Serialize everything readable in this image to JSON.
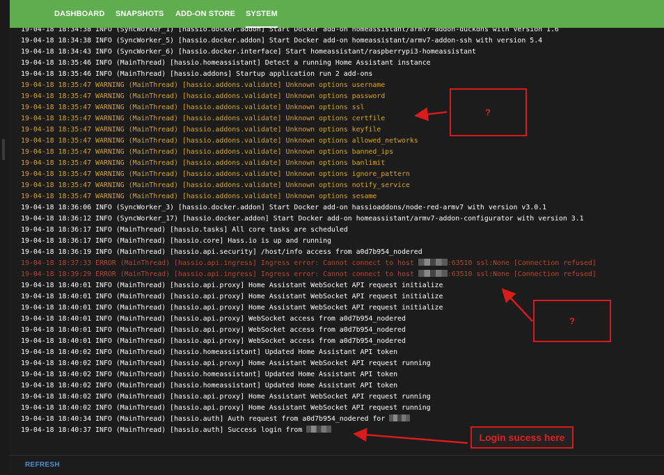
{
  "nav": {
    "tabs": [
      {
        "label": "DASHBOARD"
      },
      {
        "label": "SNAPSHOTS"
      },
      {
        "label": "ADD-ON STORE"
      },
      {
        "label": "SYSTEM"
      }
    ]
  },
  "log": {
    "lines": [
      {
        "level": "info",
        "text": "19-04-18 18:34:38 INFO (SyncWorker_1) [hassio.docker.addon] Start Docker add-on homeassistant/armv7-addon-duckdns with version 1.6"
      },
      {
        "level": "info",
        "text": "19-04-18 18:34:38 INFO (SyncWorker_5) [hassio.docker.addon] Start Docker add-on homeassistant/armv7-addon-ssh with version 5.4"
      },
      {
        "level": "info",
        "text": "19-04-18 18:34:43 INFO (SyncWorker_6) [hassio.docker.interface] Start homeassistant/raspberrypi3-homeassistant"
      },
      {
        "level": "info",
        "text": "19-04-18 18:35:46 INFO (MainThread) [hassio.homeassistant] Detect a running Home Assistant instance"
      },
      {
        "level": "info",
        "text": "19-04-18 18:35:46 INFO (MainThread) [hassio.addons] Startup application run 2 add-ons"
      },
      {
        "level": "warn",
        "text": "19-04-18 18:35:47 WARNING (MainThread) [hassio.addons.validate] Unknown options username"
      },
      {
        "level": "warn",
        "text": "19-04-18 18:35:47 WARNING (MainThread) [hassio.addons.validate] Unknown options password"
      },
      {
        "level": "warn",
        "text": "19-04-18 18:35:47 WARNING (MainThread) [hassio.addons.validate] Unknown options ssl"
      },
      {
        "level": "warn",
        "text": "19-04-18 18:35:47 WARNING (MainThread) [hassio.addons.validate] Unknown options certfile"
      },
      {
        "level": "warn",
        "text": "19-04-18 18:35:47 WARNING (MainThread) [hassio.addons.validate] Unknown options keyfile"
      },
      {
        "level": "warn",
        "text": "19-04-18 18:35:47 WARNING (MainThread) [hassio.addons.validate] Unknown options allowed_networks"
      },
      {
        "level": "warn",
        "text": "19-04-18 18:35:47 WARNING (MainThread) [hassio.addons.validate] Unknown options banned_ips"
      },
      {
        "level": "warn",
        "text": "19-04-18 18:35:47 WARNING (MainThread) [hassio.addons.validate] Unknown options banlimit"
      },
      {
        "level": "warn",
        "text": "19-04-18 18:35:47 WARNING (MainThread) [hassio.addons.validate] Unknown options ignore_pattern"
      },
      {
        "level": "warn",
        "text": "19-04-18 18:35:47 WARNING (MainThread) [hassio.addons.validate] Unknown options notify_service"
      },
      {
        "level": "warn",
        "text": "19-04-18 18:35:47 WARNING (MainThread) [hassio.addons.validate] Unknown options sesame"
      },
      {
        "level": "info",
        "text": "19-04-18 18:36:06 INFO (SyncWorker_3) [hassio.docker.addon] Start Docker add-on hassioaddons/node-red-armv7 with version v3.0.1"
      },
      {
        "level": "info",
        "text": "19-04-18 18:36:12 INFO (SyncWorker_17) [hassio.docker.addon] Start Docker add-on homeassistant/armv7-addon-configurator with version 3.1"
      },
      {
        "level": "info",
        "text": "19-04-18 18:36:17 INFO (MainThread) [hassio.tasks] All core tasks are scheduled"
      },
      {
        "level": "info",
        "text": "19-04-18 18:36:17 INFO (MainThread) [hassio.core] Hass.io is up and running"
      },
      {
        "level": "info",
        "text": "19-04-18 18:36:19 INFO (MainThread) [hassio.api.security] /host/info access from a0d7b954_nodered"
      },
      {
        "level": "err",
        "text": "19-04-18 18:37:33 ERROR (MainThread) [hassio.api.ingress] Ingress error: Cannot connect to host ",
        "redact": 7,
        "tail": ":63510 ssl:None [Connection refused]"
      },
      {
        "level": "err",
        "text": "19-04-18 18:39:29 ERROR (MainThread) [hassio.api.ingress] Ingress error: Cannot connect to host ",
        "redact": 7,
        "tail": ":63510 ssl:None [Connection refused]"
      },
      {
        "level": "info",
        "text": "19-04-18 18:40:01 INFO (MainThread) [hassio.api.proxy] Home Assistant WebSocket API request initialize"
      },
      {
        "level": "info",
        "text": "19-04-18 18:40:01 INFO (MainThread) [hassio.api.proxy] Home Assistant WebSocket API request initialize"
      },
      {
        "level": "info",
        "text": "19-04-18 18:40:01 INFO (MainThread) [hassio.api.proxy] Home Assistant WebSocket API request initialize"
      },
      {
        "level": "info",
        "text": "19-04-18 18:40:01 INFO (MainThread) [hassio.api.proxy] WebSocket access from a0d7b954_nodered"
      },
      {
        "level": "info",
        "text": "19-04-18 18:40:01 INFO (MainThread) [hassio.api.proxy] WebSocket access from a0d7b954_nodered"
      },
      {
        "level": "info",
        "text": "19-04-18 18:40:01 INFO (MainThread) [hassio.api.proxy] WebSocket access from a0d7b954_nodered"
      },
      {
        "level": "info",
        "text": "19-04-18 18:40:02 INFO (MainThread) [hassio.homeassistant] Updated Home Assistant API token"
      },
      {
        "level": "info",
        "text": "19-04-18 18:40:02 INFO (MainThread) [hassio.api.proxy] Home Assistant WebSocket API request running"
      },
      {
        "level": "info",
        "text": "19-04-18 18:40:02 INFO (MainThread) [hassio.homeassistant] Updated Home Assistant API token"
      },
      {
        "level": "info",
        "text": "19-04-18 18:40:02 INFO (MainThread) [hassio.homeassistant] Updated Home Assistant API token"
      },
      {
        "level": "info",
        "text": "19-04-18 18:40:02 INFO (MainThread) [hassio.api.proxy] Home Assistant WebSocket API request running"
      },
      {
        "level": "info",
        "text": "19-04-18 18:40:02 INFO (MainThread) [hassio.api.proxy] Home Assistant WebSocket API request running"
      },
      {
        "level": "info",
        "text": "19-04-18 18:40:34 INFO (MainThread) [hassio.auth] Auth request from a0d7b954_nodered for ",
        "redact": 5,
        "tail": ""
      },
      {
        "level": "info",
        "text": "19-04-18 18:40:37 INFO (MainThread) [hassio.auth] Success login from ",
        "redact": 6,
        "tail": ""
      }
    ]
  },
  "footer": {
    "refresh_label": "REFRESH"
  },
  "annotations": {
    "question_1": "?",
    "question_2": "?",
    "login_label": "Login sucess here",
    "color": "#d91b1b"
  },
  "colors": {
    "header_green": "#5fad4f",
    "info": "#ffffff",
    "warning": "#d6a322",
    "error": "#b8442e",
    "refresh": "#4e8fcf"
  }
}
